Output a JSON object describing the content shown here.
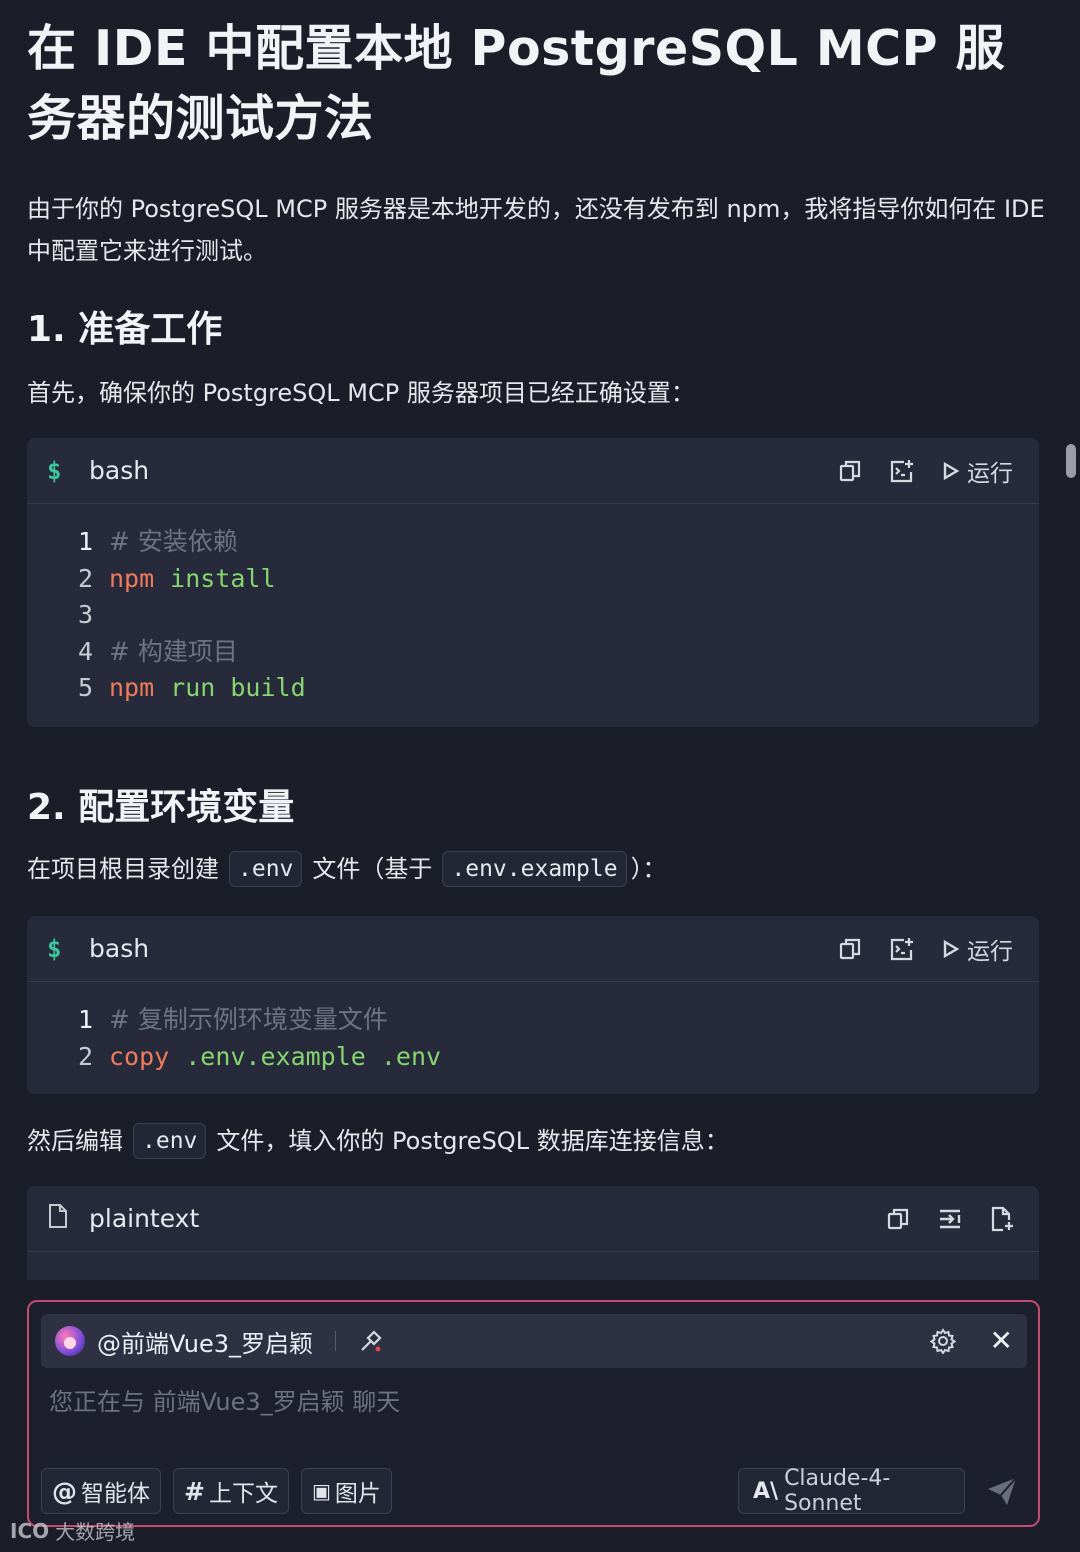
{
  "title": "在 IDE 中配置本地 PostgreSQL MCP 服务器的测试方法",
  "intro": "由于你的 PostgreSQL MCP 服务器是本地开发的，还没有发布到 npm，我将指导你如何在 IDE 中配置它来进行测试。",
  "section1": {
    "heading": "1. 准备工作",
    "text": "首先，确保你的 PostgreSQL MCP 服务器项目已经正确设置："
  },
  "code1": {
    "lang_icon": "$",
    "lang": "bash",
    "run_label": "运行",
    "lines": [
      {
        "n": "1",
        "comment": "# 安装依赖"
      },
      {
        "n": "2",
        "cmd": "npm",
        "args": "install"
      },
      {
        "n": "3"
      },
      {
        "n": "4",
        "comment": "# 构建项目"
      },
      {
        "n": "5",
        "cmd": "npm",
        "args": "run build"
      }
    ]
  },
  "section2": {
    "heading": "2. 配置环境变量",
    "text_before": "在项目根目录创建",
    "code_env": ".env",
    "text_mid": "文件（基于",
    "code_example": ".env.example",
    "text_after": "）："
  },
  "code2": {
    "lang_icon": "$",
    "lang": "bash",
    "run_label": "运行",
    "lines": [
      {
        "n": "1",
        "comment": "# 复制示例环境变量文件"
      },
      {
        "n": "2",
        "cmd": "copy",
        "args": ".env.example .env"
      }
    ]
  },
  "section3": {
    "text_before": "然后编辑",
    "code_env": ".env",
    "text_after": "文件，填入你的 PostgreSQL 数据库连接信息："
  },
  "code3": {
    "lang": "plaintext"
  },
  "chat": {
    "agent_name": "@前端Vue3_罗启颖",
    "placeholder": "您正在与 前端Vue3_罗启颖 聊天",
    "tools": [
      {
        "symbol": "@",
        "label": "智能体"
      },
      {
        "symbol": "#",
        "label": "上下文"
      },
      {
        "symbol": "▣",
        "label": "图片"
      }
    ],
    "model_logo": "A\\",
    "model": "Claude-4-Sonnet"
  },
  "watermark": {
    "logo": "ICO",
    "text": "大数跨境"
  },
  "colors": {
    "background": "#1b1e29",
    "code_background": "#262a3a",
    "accent_border": "#c24b72",
    "command": "#ef7b5c",
    "argument": "#86d56e",
    "comment": "#6d7284"
  }
}
